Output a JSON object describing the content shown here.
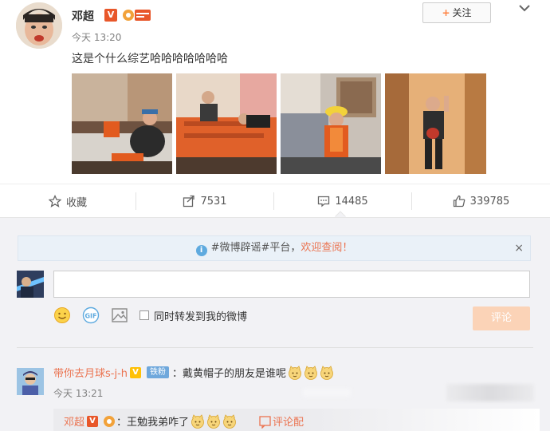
{
  "post": {
    "author": "邓超",
    "v_badge": "V",
    "time": "今天 13:20",
    "content": "这是个什么综艺哈哈哈哈哈哈哈",
    "follow_label": "关注",
    "follow_plus": "+",
    "photos": [
      "photo-1",
      "photo-2",
      "photo-3",
      "photo-4"
    ]
  },
  "actions": {
    "favorite_label": "收藏",
    "repost_count": "7531",
    "comment_count": "14485",
    "like_count": "339785"
  },
  "comment_area": {
    "notice_prefix": "#微博辟谣#平台，",
    "notice_highlight": "欢迎查阅！",
    "notice_close": "×",
    "forward_label": "同时转发到我的微博",
    "submit_label": "评论"
  },
  "comments": [
    {
      "user": "带你去月球s-j-h",
      "v_badge": "V",
      "fan_badge": "铁粉",
      "text": "：戴黄帽子的朋友是谁呢",
      "time": "今天 13:21",
      "reply": {
        "user": "邓超",
        "v_badge": "V",
        "text": "：王勉我弟咋了",
        "action_label": "评论配"
      }
    }
  ],
  "colors": {
    "accent": "#eb7350",
    "link_blue": "#5eaadf",
    "submit_disabled": "#fbd3b7"
  },
  "icons": {
    "favorite": "star-icon",
    "repost": "share-icon",
    "comment": "comment-bubble-icon",
    "like": "thumbs-up-icon",
    "emoji": "smiley-icon",
    "gif": "gif-icon",
    "image": "picture-icon"
  }
}
